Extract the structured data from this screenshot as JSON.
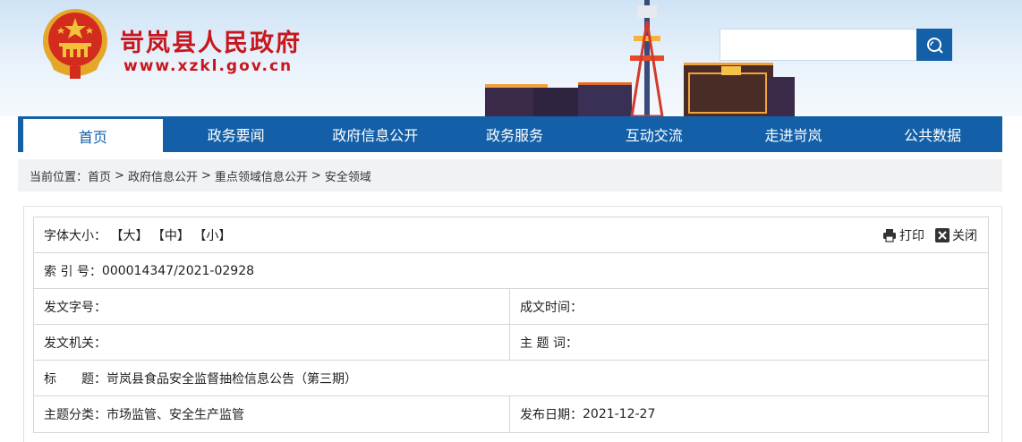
{
  "site": {
    "title": "岢岚县人民政府",
    "url": "www.xzkl.gov.cn"
  },
  "colors": {
    "brand_red": "#c8161d",
    "nav_blue": "#1360a8"
  },
  "search": {
    "placeholder": "",
    "button_icon": "search-icon"
  },
  "nav": {
    "items": [
      {
        "label": "首页",
        "active": true
      },
      {
        "label": "政务要闻"
      },
      {
        "label": "政府信息公开"
      },
      {
        "label": "政务服务"
      },
      {
        "label": "互动交流"
      },
      {
        "label": "走进岢岚"
      },
      {
        "label": "公共数据"
      }
    ]
  },
  "breadcrumb": {
    "prefix": "当前位置：",
    "items": [
      "首页",
      "政府信息公开",
      "重点领域信息公开",
      "安全领域"
    ],
    "separator": ">"
  },
  "toolbar": {
    "font_size_label": "字体大小：",
    "large": "【大】",
    "medium": "【中】",
    "small": "【小】",
    "print": "打印",
    "close": "关闭"
  },
  "info": {
    "index_label": "索 引 号：",
    "index_value": "000014347/2021-02928",
    "doc_no_label": "发文字号：",
    "doc_no_value": "",
    "created_label": "成文时间：",
    "created_value": "",
    "issuer_label": "发文机关：",
    "issuer_value": "",
    "subject_label": "主 题 词：",
    "subject_value": "",
    "title_label": "标　　题：",
    "title_value": "岢岚县食品安全监督抽检信息公告（第三期）",
    "category_label": "主题分类：",
    "category_value": "市场监管、安全生产监管",
    "publish_label": "发布日期：",
    "publish_value": "2021-12-27"
  }
}
